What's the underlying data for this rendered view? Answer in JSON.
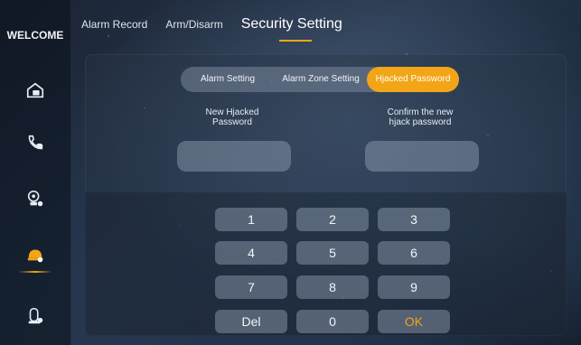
{
  "sidebar": {
    "title": "WELCOME",
    "items": [
      {
        "icon": "home-lock-icon"
      },
      {
        "icon": "phone-icon"
      },
      {
        "icon": "camera-icon"
      },
      {
        "icon": "alarm-icon",
        "active": true
      },
      {
        "icon": "intercom-icon"
      }
    ]
  },
  "header": {
    "tabs": [
      {
        "label": "Alarm Record"
      },
      {
        "label": "Arm/Disarm"
      },
      {
        "label": "Security Setting",
        "active": true
      }
    ]
  },
  "subtabs": [
    {
      "label": "Alarm Setting"
    },
    {
      "label": "Alarm Zone Setting"
    },
    {
      "label": "Hjacked Password",
      "active": true
    }
  ],
  "fields": {
    "new_label": "New Hjacked\nPassword",
    "confirm_label": "Confirm the new\nhjack password",
    "new_value": "",
    "confirm_value": ""
  },
  "keypad": [
    "1",
    "2",
    "3",
    "4",
    "5",
    "6",
    "7",
    "8",
    "9",
    "Del",
    "0",
    "OK"
  ],
  "colors": {
    "accent": "#f2a516"
  }
}
